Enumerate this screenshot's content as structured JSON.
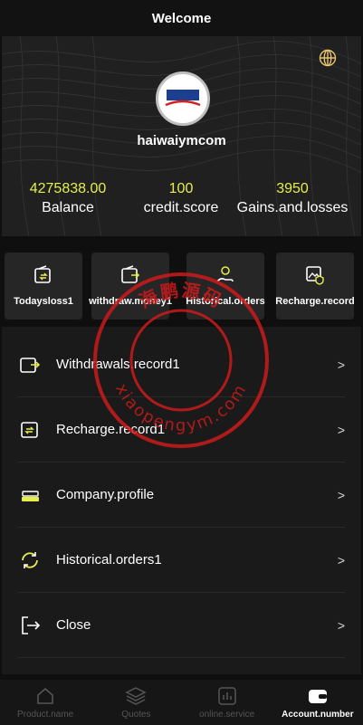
{
  "header": {
    "title": "Welcome"
  },
  "profile": {
    "username": "haiwaiymcom"
  },
  "stats": [
    {
      "value": "4275838.00",
      "label": "Balance"
    },
    {
      "value": "100",
      "label": "credit.score"
    },
    {
      "value": "3950",
      "label": "Gains.and.losses"
    }
  ],
  "quick_actions": [
    {
      "label": "Todaysloss1",
      "icon": "wallet-refresh-icon"
    },
    {
      "label": "withdraw.money1",
      "icon": "wallet-out-icon"
    },
    {
      "label": "Historical.orders",
      "icon": "hand-coin-icon"
    },
    {
      "label": "Recharge.record",
      "icon": "image-shield-icon"
    }
  ],
  "menu": [
    {
      "label": "Withdrawals.record1",
      "icon": "wallet-out-icon"
    },
    {
      "label": "Recharge.record1",
      "icon": "wallet-refresh-icon"
    },
    {
      "label": "Company.profile",
      "icon": "stack-icon"
    },
    {
      "label": "Historical.orders1",
      "icon": "refresh-icon"
    },
    {
      "label": "Close",
      "icon": "logout-icon"
    }
  ],
  "menu_chevron": ">",
  "tabs": [
    {
      "label": "Product.name",
      "icon": "home-icon",
      "active": false
    },
    {
      "label": "Quotes",
      "icon": "layers-icon",
      "active": false
    },
    {
      "label": "online.service",
      "icon": "chart-icon",
      "active": false
    },
    {
      "label": "Account.number",
      "icon": "wallet-icon",
      "active": true
    }
  ],
  "watermark": {
    "text_top": "海鹏源码",
    "text_bottom": "xiaopengym.com"
  },
  "colors": {
    "accent": "#e6ef4a",
    "stamp": "#d21a1a",
    "background": "#0f0f0f"
  }
}
